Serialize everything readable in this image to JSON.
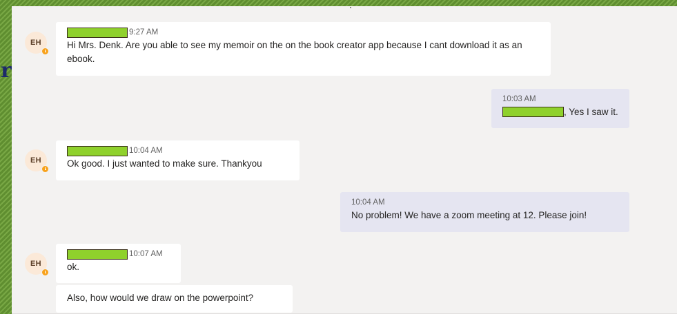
{
  "background": {
    "glyph": "r"
  },
  "messages": [
    {
      "sender_initials": "EH",
      "time": "9:27 AM",
      "text": "Hi Mrs. Denk. Are you able to see my memoir on the on the book creator app because I cant download it as an ebook."
    },
    {
      "time": "10:03 AM",
      "text": ", Yes I saw it."
    },
    {
      "sender_initials": "EH",
      "time": "10:04 AM",
      "text": "Ok good. I just wanted to make sure. Thankyou"
    },
    {
      "time": "10:04 AM",
      "text": "No problem! We have a zoom meeting at 12. Please join!"
    },
    {
      "sender_initials": "EH",
      "time": "10:07 AM",
      "text": "ok."
    },
    {
      "text": "Also, how would we draw on the powerpoint?"
    }
  ],
  "colors": {
    "redaction": "#8fd12c",
    "own_message_bubble": "#e5e5f1",
    "other_message_bubble": "#ffffff",
    "status_away": "#f8a21c",
    "avatar_bg": "#fbe9d8"
  }
}
